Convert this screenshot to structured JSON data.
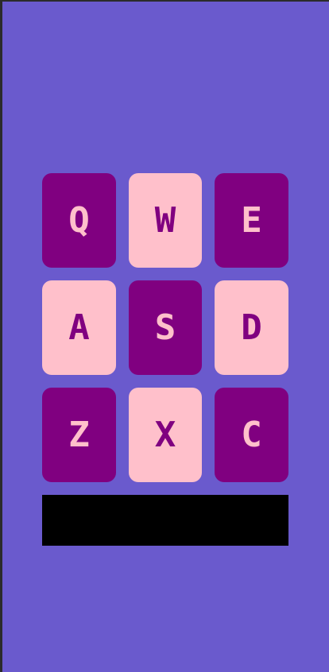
{
  "colors": {
    "background": "#6a5acd",
    "key_dark_bg": "#800080",
    "key_dark_fg": "#ffc0cb",
    "key_light_bg": "#ffc0cb",
    "key_light_fg": "#800080",
    "output_bar": "#000000"
  },
  "keypad": {
    "keys": [
      {
        "label": "Q",
        "style": "dark"
      },
      {
        "label": "W",
        "style": "light"
      },
      {
        "label": "E",
        "style": "dark"
      },
      {
        "label": "A",
        "style": "light"
      },
      {
        "label": "S",
        "style": "dark"
      },
      {
        "label": "D",
        "style": "light"
      },
      {
        "label": "Z",
        "style": "dark"
      },
      {
        "label": "X",
        "style": "light"
      },
      {
        "label": "C",
        "style": "dark"
      }
    ]
  },
  "output": {
    "text": ""
  }
}
